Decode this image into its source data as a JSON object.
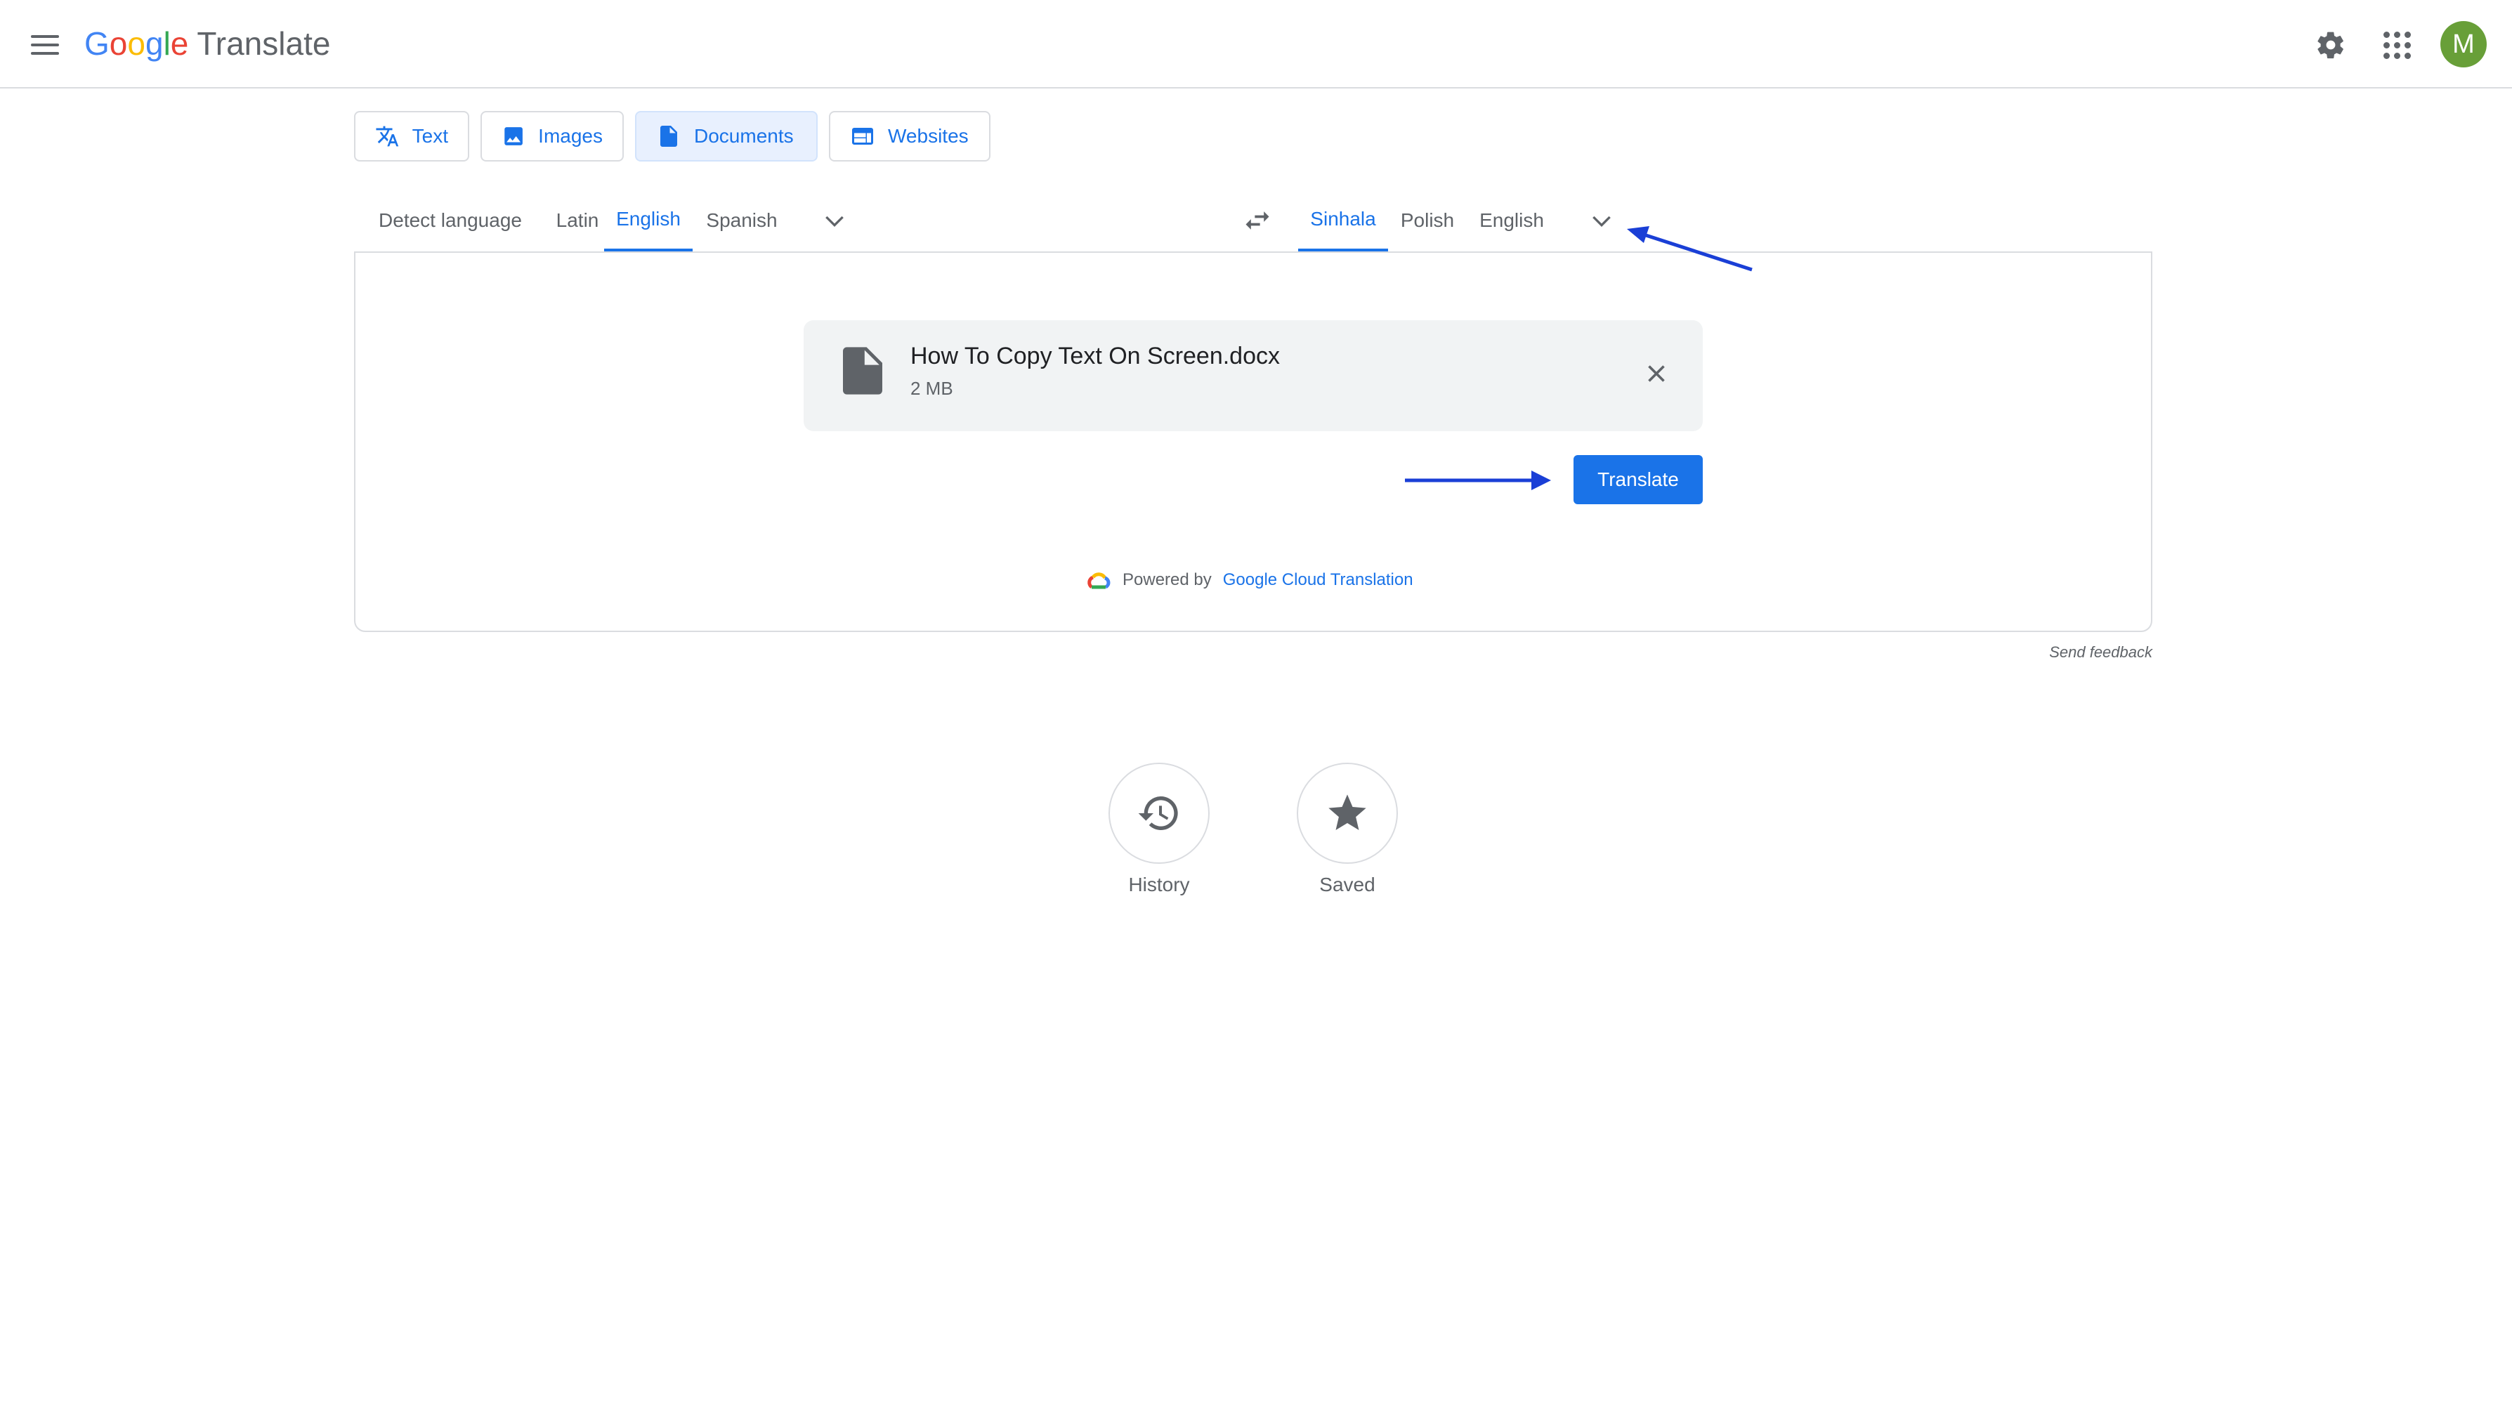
{
  "header": {
    "logo_letters": [
      "G",
      "o",
      "o",
      "g",
      "l",
      "e"
    ],
    "product": "Translate",
    "avatar_initial": "M"
  },
  "modes": [
    {
      "label": "Text",
      "icon": "translate-icon"
    },
    {
      "label": "Images",
      "icon": "image-icon"
    },
    {
      "label": "Documents",
      "icon": "document-icon",
      "active": true
    },
    {
      "label": "Websites",
      "icon": "web-icon"
    }
  ],
  "source_languages": [
    "Detect language",
    "Latin",
    "English",
    "Spanish"
  ],
  "source_active": "English",
  "target_languages": [
    "Sinhala",
    "Polish",
    "English"
  ],
  "target_active": "Sinhala",
  "file": {
    "name": "How To Copy Text On Screen.docx",
    "size": "2 MB"
  },
  "translate_button": "Translate",
  "powered": {
    "prefix": "Powered by",
    "link": "Google Cloud Translation"
  },
  "feedback": "Send feedback",
  "history_label": "History",
  "saved_label": "Saved",
  "colors": {
    "accent": "#1a73e8",
    "annotation_arrow": "#1a3fd6",
    "avatar": "#689f38"
  }
}
